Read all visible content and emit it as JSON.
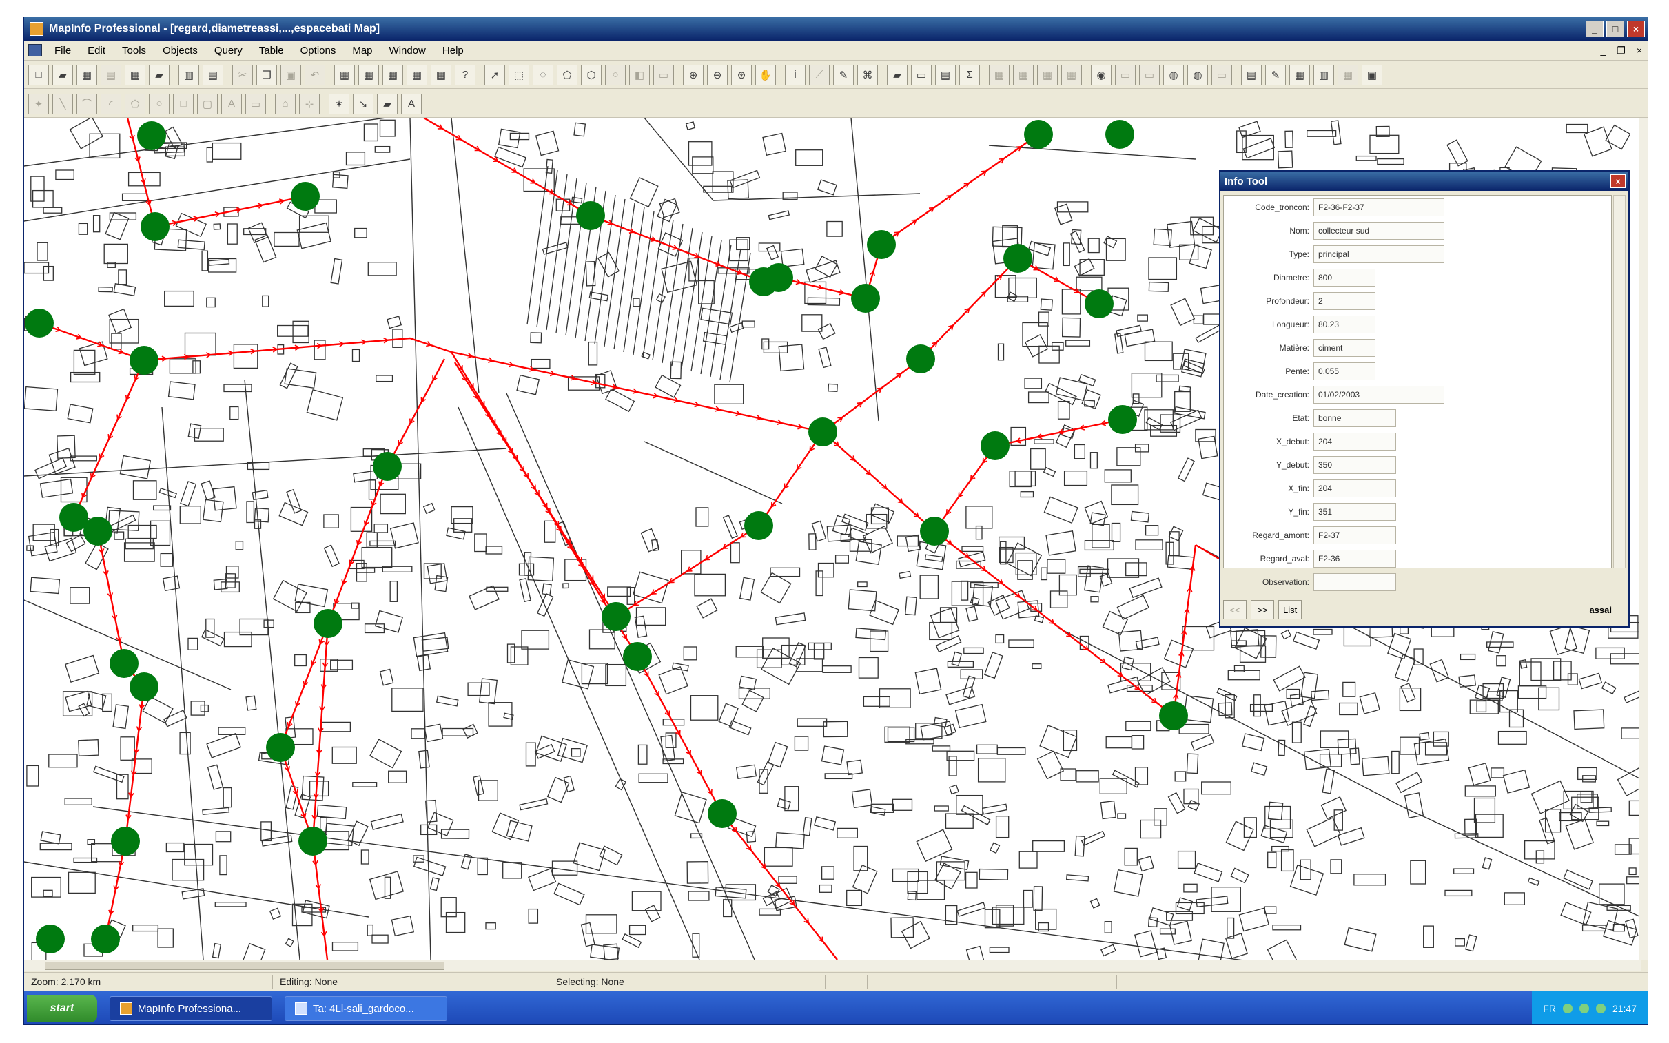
{
  "window": {
    "title": "MapInfo Professional - [regard,diametreassi,...,espacebati Map]",
    "controls": {
      "minimize": "_",
      "maximize": "□",
      "close": "×"
    }
  },
  "menu": {
    "items": [
      "File",
      "Edit",
      "Tools",
      "Objects",
      "Query",
      "Table",
      "Options",
      "Map",
      "Window",
      "Help"
    ],
    "mdi_controls": {
      "minimize": "_",
      "restore": "❐",
      "close": "×"
    }
  },
  "map": {
    "background": "#ffffff",
    "pipe_color": "#ff0000",
    "manhole_color": "#007a10",
    "building_color": "#333333"
  },
  "info_tool": {
    "title": "Info Tool",
    "close": "×",
    "fields": [
      {
        "label": "Code_troncon:",
        "value": "F2-36-F2-37"
      },
      {
        "label": "Nom:",
        "value": "collecteur sud"
      },
      {
        "label": "Type:",
        "value": "principal"
      },
      {
        "label": "Diametre:",
        "value": "800"
      },
      {
        "label": "Profondeur:",
        "value": "2"
      },
      {
        "label": "Longueur:",
        "value": "80.23"
      },
      {
        "label": "Matière:",
        "value": "ciment"
      },
      {
        "label": "Pente:",
        "value": "0.055"
      },
      {
        "label": "Date_creation:",
        "value": "01/02/2003"
      },
      {
        "label": "Etat:",
        "value": "bonne"
      },
      {
        "label": "X_debut:",
        "value": "204"
      },
      {
        "label": "Y_debut:",
        "value": "350"
      },
      {
        "label": "X_fin:",
        "value": "204"
      },
      {
        "label": "Y_fin:",
        "value": "351"
      },
      {
        "label": "Regard_amont:",
        "value": "F2-37"
      },
      {
        "label": "Regard_aval:",
        "value": "F2-36"
      },
      {
        "label": "Observation:",
        "value": ""
      }
    ],
    "nav": {
      "prev": "<<",
      "next": ">>",
      "list": "List"
    },
    "layer": "assai"
  },
  "status": {
    "zoom": "Zoom: 2.170 km",
    "editing": "Editing: None",
    "selecting": "Selecting: None"
  },
  "taskbar": {
    "start": "start",
    "tasks": [
      "MapInfo Professiona...",
      "Ta: 4Ll-sali_gardoco..."
    ],
    "tray_lang": "FR",
    "clock": "21:47"
  }
}
